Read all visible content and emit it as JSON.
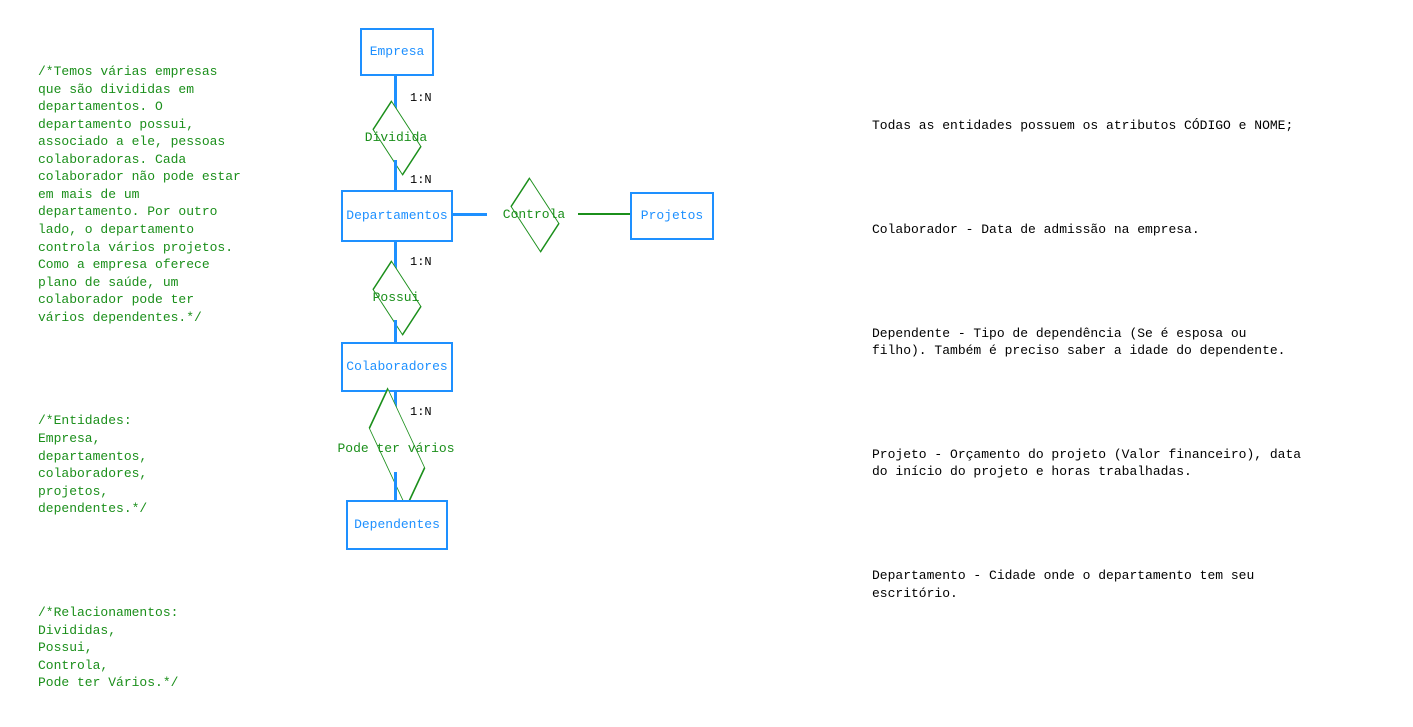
{
  "left": {
    "p1": "/*Temos várias empresas que são divididas em departamentos. O departamento possui, associado a ele, pessoas colaboradoras. Cada colaborador não pode estar em mais de um departamento. Por outro lado, o departamento controla vários projetos. Como a empresa oferece plano de saúde, um colaborador pode ter vários dependentes.*/",
    "p2": "/*Entidades:\nEmpresa,\ndepartamentos,\ncolaboradores,\nprojetos,\ndependentes.*/",
    "p3": "/*Relacionamentos:\nDivididas,\nPossui,\nControla,\nPode ter Vários.*/"
  },
  "right": {
    "r1": "Todas as entidades possuem os atributos CÓDIGO e NOME;",
    "r2": "Colaborador - Data de admissão na empresa.",
    "r3": "Dependente - Tipo de dependência (Se é esposa ou filho). Também é preciso saber a idade do dependente.",
    "r4": "Projeto - Orçamento do projeto (Valor financeiro), data do início do projeto e horas trabalhadas.",
    "r5": "Departamento - Cidade onde o departamento tem seu escritório."
  },
  "diagram": {
    "entities": {
      "empresa": "Empresa",
      "departamentos": "Departamentos",
      "colaboradores": "Colaboradores",
      "dependentes": "Dependentes",
      "projetos": "Projetos"
    },
    "relationships": {
      "dividida": "Dividida",
      "controla": "Controla",
      "possui": "Possui",
      "pode_ter_varios": "Pode ter vários"
    },
    "cardinalities": {
      "c1": "1:N",
      "c2": "1:N",
      "c3": "1:N",
      "c4": "1:N"
    }
  },
  "chart_data": {
    "type": "er-diagram",
    "entities": [
      {
        "name": "Empresa"
      },
      {
        "name": "Departamentos"
      },
      {
        "name": "Colaboradores"
      },
      {
        "name": "Dependentes"
      },
      {
        "name": "Projetos"
      }
    ],
    "relationships": [
      {
        "name": "Dividida",
        "between": [
          "Empresa",
          "Departamentos"
        ],
        "cardinality": "1:N"
      },
      {
        "name": "Controla",
        "between": [
          "Departamentos",
          "Projetos"
        ],
        "cardinality": "1:N"
      },
      {
        "name": "Possui",
        "between": [
          "Departamentos",
          "Colaboradores"
        ],
        "cardinality": "1:N"
      },
      {
        "name": "Pode ter vários",
        "between": [
          "Colaboradores",
          "Dependentes"
        ],
        "cardinality": "1:N"
      }
    ]
  }
}
